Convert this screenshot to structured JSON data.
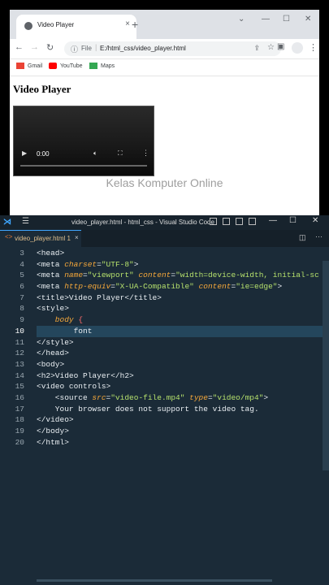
{
  "browser": {
    "tab_title": "Video Player",
    "tab_close": "×",
    "new_tab": "+",
    "url_scheme": "File",
    "url": "E:/html_css/video_player.html",
    "bookmarks": [
      {
        "label": "Gmail",
        "color": "#ea4335"
      },
      {
        "label": "YouTube",
        "color": "#ff0000"
      },
      {
        "label": "Maps",
        "color": "#34a853"
      }
    ],
    "window_controls": [
      "⌄",
      "—",
      "☐",
      "✕"
    ]
  },
  "page": {
    "heading": "Video Player",
    "video_time": "0:00"
  },
  "watermark": "Kelas Komputer Online",
  "vscode": {
    "window_title": "video_player.html - html_css - Visual Studio Code",
    "tab_name": "video_player.html 1",
    "tab_close": "×",
    "window_controls": [
      "—",
      "☐",
      "✕"
    ],
    "accent": "#3fa6ff",
    "lines": [
      {
        "n": "3",
        "segs": [
          [
            "t",
            "<head>"
          ]
        ]
      },
      {
        "n": "4",
        "segs": [
          [
            "t",
            "<meta "
          ],
          [
            "a",
            "charset"
          ],
          [
            "t",
            "="
          ],
          [
            "s",
            "\"UTF-8\""
          ],
          [
            "t",
            ">"
          ]
        ]
      },
      {
        "n": "5",
        "segs": [
          [
            "t",
            "<meta "
          ],
          [
            "a",
            "name"
          ],
          [
            "t",
            "="
          ],
          [
            "s",
            "\"viewport\""
          ],
          [
            "t",
            " "
          ],
          [
            "a",
            "content"
          ],
          [
            "t",
            "="
          ],
          [
            "s",
            "\"width=device-width, initial-sc"
          ]
        ]
      },
      {
        "n": "6",
        "segs": [
          [
            "t",
            "<meta "
          ],
          [
            "a",
            "http-equiv"
          ],
          [
            "t",
            "="
          ],
          [
            "s",
            "\"X-UA-Compatible\""
          ],
          [
            "t",
            " "
          ],
          [
            "a",
            "content"
          ],
          [
            "t",
            "="
          ],
          [
            "s",
            "\"ie=edge\""
          ],
          [
            "t",
            ">"
          ]
        ]
      },
      {
        "n": "7",
        "segs": [
          [
            "t",
            "<title>Video Player</title>"
          ]
        ]
      },
      {
        "n": "8",
        "segs": [
          [
            "t",
            "<style>"
          ]
        ]
      },
      {
        "n": "9",
        "segs": [
          [
            "a",
            "    body "
          ],
          [
            "p",
            "{"
          ]
        ]
      },
      {
        "n": "10",
        "segs": [
          [
            "t",
            "        font"
          ]
        ],
        "current": true
      },
      {
        "n": "11",
        "segs": [
          [
            "t",
            "</style>"
          ]
        ]
      },
      {
        "n": "12",
        "segs": [
          [
            "t",
            "</head>"
          ]
        ]
      },
      {
        "n": "13",
        "segs": [
          [
            "t",
            "<body>"
          ]
        ]
      },
      {
        "n": "14",
        "segs": [
          [
            "t",
            "<h2>Video Player</h2>"
          ]
        ]
      },
      {
        "n": "15",
        "segs": [
          [
            "t",
            "<video controls>"
          ]
        ]
      },
      {
        "n": "16",
        "segs": [
          [
            "t",
            "    <source "
          ],
          [
            "a",
            "src"
          ],
          [
            "t",
            "="
          ],
          [
            "s",
            "\"video-file.mp4\""
          ],
          [
            "t",
            " "
          ],
          [
            "a",
            "type"
          ],
          [
            "t",
            "="
          ],
          [
            "s",
            "\"video/mp4\""
          ],
          [
            "t",
            ">"
          ]
        ]
      },
      {
        "n": "17",
        "segs": [
          [
            "t",
            "    Your browser does not support the video tag."
          ]
        ]
      },
      {
        "n": "18",
        "segs": [
          [
            "t",
            "</video>"
          ]
        ]
      },
      {
        "n": "19",
        "segs": [
          [
            "t",
            "</body>"
          ]
        ]
      },
      {
        "n": "20",
        "segs": [
          [
            "t",
            "</html>"
          ]
        ]
      }
    ]
  }
}
